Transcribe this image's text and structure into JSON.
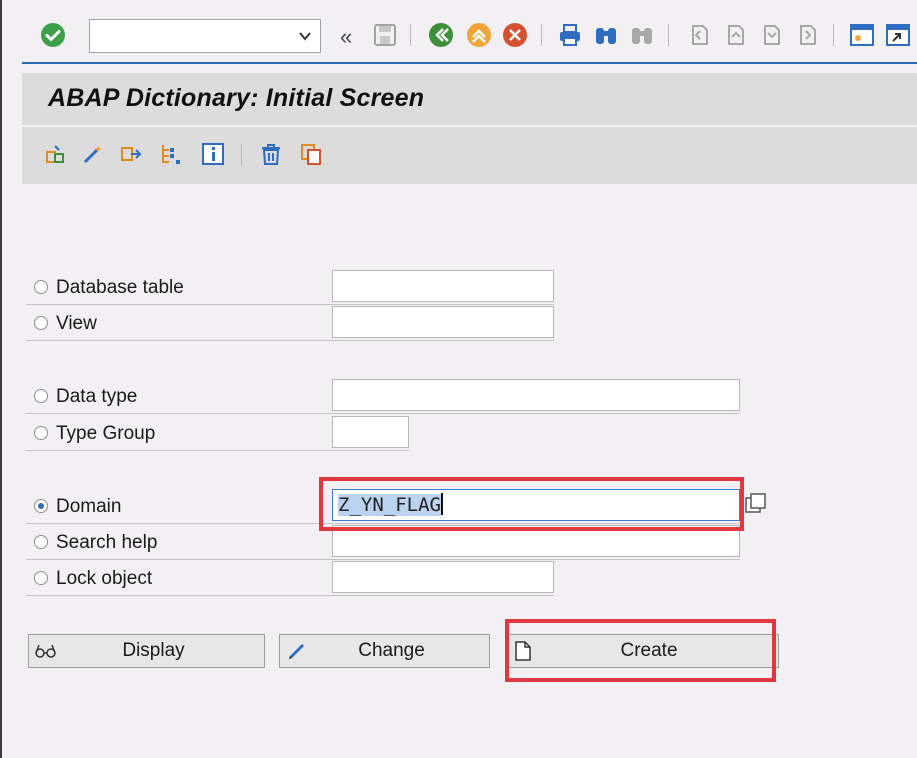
{
  "toolbar": {
    "command_field_value": "",
    "icons": [
      "enter-icon",
      "command-dropdown-icon",
      "collapse-icon",
      "save-icon",
      "back-icon",
      "exit-icon",
      "cancel-icon",
      "print-icon",
      "find-icon",
      "find-next-icon",
      "first-page-icon",
      "previous-page-icon",
      "next-page-icon",
      "last-page-icon",
      "create-session-icon",
      "shortcut-icon"
    ]
  },
  "title": "ABAP Dictionary: Initial Screen",
  "app_toolbar": {
    "icons": [
      "other-object-icon",
      "check-icon",
      "where-used-icon",
      "display-object-list-icon",
      "info-icon",
      "delete-icon",
      "copy-icon"
    ]
  },
  "form": {
    "database_table": {
      "label": "Database table",
      "value": ""
    },
    "view": {
      "label": "View",
      "value": ""
    },
    "data_type": {
      "label": "Data type",
      "value": ""
    },
    "type_group": {
      "label": "Type Group",
      "value": ""
    },
    "domain": {
      "label": "Domain",
      "value": "Z_YN_FLAG",
      "selected": true
    },
    "search_help": {
      "label": "Search help",
      "value": ""
    },
    "lock_object": {
      "label": "Lock object",
      "value": ""
    }
  },
  "buttons": {
    "display": "Display",
    "change": "Change",
    "create": "Create"
  },
  "colors": {
    "highlight": "#e0383e",
    "accent": "#2f6dc1",
    "background": "#f2f0f3",
    "title_bar": "#dcdcdc"
  }
}
